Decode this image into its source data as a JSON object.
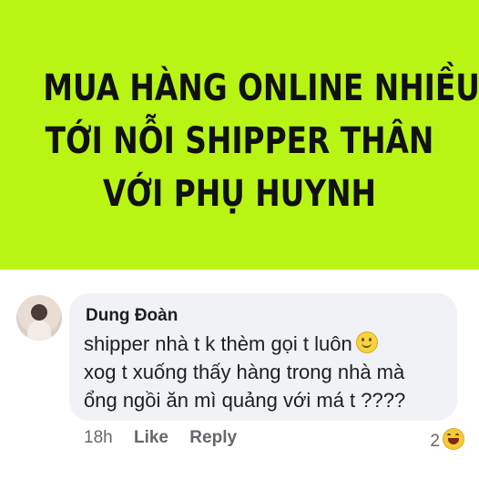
{
  "banner": {
    "background_color": "#b8f514",
    "headline_lines": [
      "MUA HÀNG ONLINE NHIỀU",
      "TỚI NỖI SHIPPER THÂN",
      "VỚI PHỤ HUYNH"
    ]
  },
  "comment": {
    "author": "Dung Đoàn",
    "text_lines": [
      "shipper nhà t k thèm gọi t luôn",
      "xog t xuống thấy hàng trong nhà mà",
      "ổng ngồi ăn mì quảng với má t ????"
    ],
    "emoji": "slightly-smiling-face-icon",
    "time": "18h",
    "like_label": "Like",
    "reply_label": "Reply",
    "reaction_count": "2",
    "reaction_icon": "haha-reaction-icon"
  }
}
